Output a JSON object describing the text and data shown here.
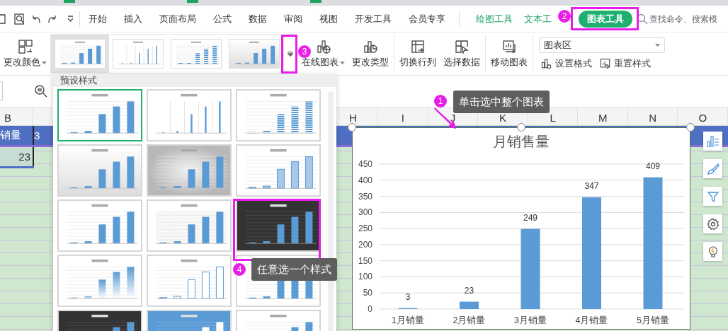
{
  "menu_tabs": [
    {
      "label": "开始",
      "kind": "normal",
      "selected": false
    },
    {
      "label": "插入",
      "kind": "normal",
      "selected": false
    },
    {
      "label": "页面布局",
      "kind": "normal",
      "selected": false
    },
    {
      "label": "公式",
      "kind": "normal",
      "selected": false
    },
    {
      "label": "数据",
      "kind": "normal",
      "selected": false
    },
    {
      "label": "审阅",
      "kind": "normal",
      "selected": false
    },
    {
      "label": "视图",
      "kind": "normal",
      "selected": false
    },
    {
      "label": "开发工具",
      "kind": "normal",
      "selected": false
    },
    {
      "label": "会员专享",
      "kind": "normal",
      "selected": false
    },
    {
      "label": "绘图工具",
      "kind": "context",
      "selected": false
    },
    {
      "label": "文本工",
      "kind": "context",
      "selected": false
    },
    {
      "label": "图表工具",
      "kind": "context",
      "selected": true
    }
  ],
  "search": {
    "placeholder": "查找命令、搜索模"
  },
  "ribbon": {
    "change_color": "更改颜色",
    "styles": [
      {
        "kind": "plain",
        "selected": true
      },
      {
        "kind": "gridless",
        "selected": false
      },
      {
        "kind": "striped",
        "selected": false
      },
      {
        "kind": "shaded",
        "selected": false
      }
    ],
    "online_chart": "在线图表",
    "change_type": "更改类型",
    "switch_rows": "切换行列",
    "select_data": "选择数据",
    "move_chart": "移动图表",
    "element_select": {
      "value": "图表区"
    },
    "set_format": "设置格式",
    "reset_style": "重置样式"
  },
  "style_panel": {
    "title": "预设样式",
    "styles": [
      {
        "kind": "plain",
        "selected": true
      },
      {
        "kind": "gridless",
        "selected": false
      },
      {
        "kind": "striped",
        "selected": false
      },
      {
        "kind": "shaded",
        "selected": false
      },
      {
        "kind": "gray",
        "selected": false
      },
      {
        "kind": "outline",
        "selected": false
      },
      {
        "kind": "plain",
        "selected": false
      },
      {
        "kind": "hatched",
        "selected": false
      },
      {
        "kind": "dark",
        "selected": false
      },
      {
        "kind": "fade",
        "selected": false
      },
      {
        "kind": "hollow",
        "selected": false
      },
      {
        "kind": "plain",
        "selected": false
      },
      {
        "kind": "dark",
        "selected": false
      },
      {
        "kind": "blue",
        "selected": false
      },
      {
        "kind": "plain",
        "selected": false
      }
    ]
  },
  "sheet": {
    "left_column": "B",
    "columns": [
      "H",
      "I",
      "J",
      "K",
      "L",
      "M",
      "N",
      "O"
    ],
    "rows": [
      {
        "kind": "header",
        "cells": [
          "销量",
          "3"
        ]
      },
      {
        "kind": "data",
        "cells": [
          "23"
        ]
      }
    ]
  },
  "chart": {
    "chart_data": {
      "type": "bar",
      "title": "月销售量",
      "categories": [
        "1月销量",
        "2月销量",
        "3月销量",
        "4月销量",
        "5月销量"
      ],
      "values": [
        3,
        23,
        249,
        347,
        409
      ],
      "ylim": [
        0,
        450
      ],
      "yticks": [
        0,
        50,
        100,
        150,
        200,
        250,
        300,
        350,
        400,
        450
      ],
      "data_labels": true,
      "grid": true
    }
  },
  "callouts": [
    {
      "number": "1",
      "text": "单击选中整个图表"
    },
    {
      "number": "2"
    },
    {
      "number": "3"
    },
    {
      "number": "4",
      "text": "任意选一个样式"
    }
  ]
}
